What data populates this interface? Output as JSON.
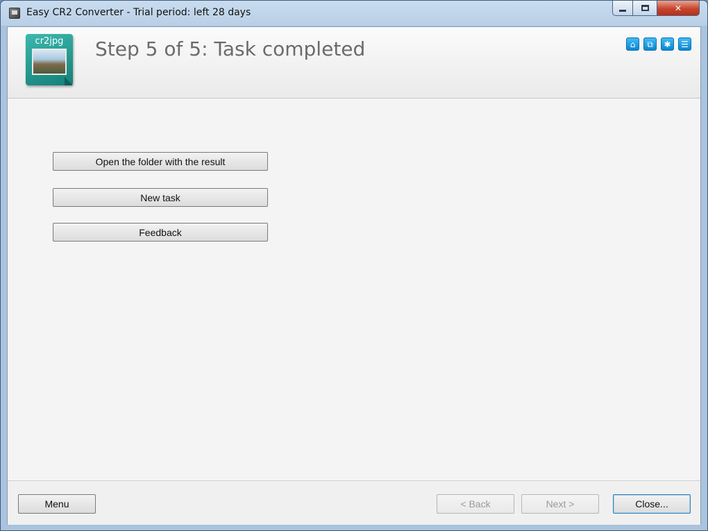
{
  "window": {
    "title": "Easy CR2 Converter - Trial period: left 28 days",
    "controls": {
      "minimize": "minimize",
      "maximize": "maximize",
      "close": "✕"
    }
  },
  "header": {
    "logo_label": "cr2jpg",
    "step_title": "Step 5 of 5: Task completed",
    "icons": [
      "home-icon",
      "network-icon",
      "settings-gear-icon",
      "contact-card-icon"
    ]
  },
  "actions": {
    "open_folder": "Open the folder with the result",
    "new_task": "New task",
    "feedback": "Feedback"
  },
  "footer": {
    "menu": "Menu",
    "back": "< Back",
    "next": "Next >",
    "close": "Close..."
  }
}
